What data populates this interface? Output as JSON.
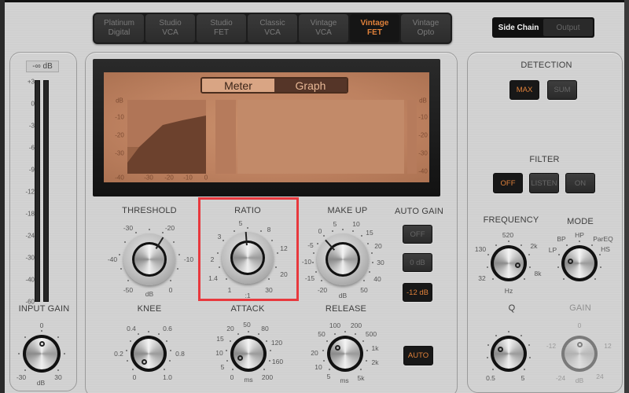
{
  "models": [
    {
      "label": "Platinum\nDigital",
      "line1": "Platinum",
      "line2": "Digital",
      "active": false
    },
    {
      "line1": "Studio",
      "line2": "VCA",
      "active": false
    },
    {
      "line1": "Studio",
      "line2": "FET",
      "active": false
    },
    {
      "line1": "Classic",
      "line2": "VCA",
      "active": false
    },
    {
      "line1": "Vintage",
      "line2": "VCA",
      "active": false
    },
    {
      "line1": "Vintage",
      "line2": "FET",
      "active": true
    },
    {
      "line1": "Vintage",
      "line2": "Opto",
      "active": false
    }
  ],
  "sidechain_toggle": {
    "side_chain": "Side Chain",
    "output": "Output",
    "selected": "Side Chain"
  },
  "input_meter": {
    "readout": "-∞ dB",
    "scale": [
      "+3",
      "0",
      "-3",
      "-6",
      "-9",
      "-12",
      "-18",
      "-24",
      "-30",
      "-40",
      "-60"
    ]
  },
  "input_gain": {
    "label": "INPUT GAIN",
    "top": "0",
    "min": "-30",
    "max": "30",
    "unit": "dB",
    "value_db": 0
  },
  "display": {
    "tabs": {
      "meter": "Meter",
      "graph": "Graph",
      "selected": "Graph"
    },
    "graph_y_labels": [
      "dB",
      "-10",
      "-20",
      "-30",
      "-40"
    ],
    "graph_x_labels": [
      "-30",
      "-20",
      "-10",
      "0"
    ],
    "right_labels": [
      "dB",
      "-10",
      "-20",
      "-30",
      "-40"
    ]
  },
  "threshold": {
    "label": "THRESHOLD",
    "scale": [
      "-30",
      "-20",
      "-40",
      "-10",
      "-50",
      "0"
    ],
    "unit": "dB",
    "value_db": -20
  },
  "ratio": {
    "label": "RATIO",
    "scale": [
      "5",
      "8",
      "3",
      "12",
      "2",
      "20",
      "1.4",
      "30",
      "1"
    ],
    "unit": ":1",
    "value": 5
  },
  "make_up": {
    "label": "MAKE UP",
    "scale": [
      "5",
      "10",
      "0",
      "15",
      "-5",
      "20",
      "-10",
      "30",
      "-15",
      "40",
      "-20",
      "50"
    ],
    "unit": "dB",
    "value_db": 0
  },
  "auto_gain": {
    "label": "AUTO GAIN",
    "options": [
      "OFF",
      "0 dB",
      "-12 dB"
    ],
    "selected": "-12 dB"
  },
  "knee": {
    "label": "KNEE",
    "scale": [
      "0.4",
      "0.6",
      "0.2",
      "0.8",
      "0",
      "1.0"
    ],
    "value": 0.1
  },
  "attack": {
    "label": "ATTACK",
    "scale": [
      "50",
      "20",
      "80",
      "15",
      "120",
      "10",
      "160",
      "5",
      "0",
      "200"
    ],
    "unit": "ms",
    "value_ms": 10
  },
  "release": {
    "label": "RELEASE",
    "scale": [
      "100",
      "200",
      "50",
      "500",
      "1k",
      "20",
      "2k",
      "10",
      "5",
      "5k"
    ],
    "unit": "ms",
    "value_ms": 20,
    "auto_label": "AUTO"
  },
  "detection": {
    "label": "DETECTION",
    "options": [
      "MAX",
      "SUM"
    ],
    "selected": "MAX"
  },
  "filter": {
    "label": "FILTER",
    "options": [
      "OFF",
      "LISTEN",
      "ON"
    ],
    "selected": "OFF"
  },
  "frequency": {
    "label": "FREQUENCY",
    "scale": [
      "520",
      "130",
      "2k",
      "32",
      "8k"
    ],
    "unit": "Hz"
  },
  "mode": {
    "label": "MODE",
    "scale": [
      "HP",
      "BP",
      "ParEQ",
      "LP",
      "HS"
    ],
    "value": "LP"
  },
  "q": {
    "label": "Q",
    "min": "0.5",
    "max": "5"
  },
  "gain": {
    "label": "GAIN",
    "top": "0",
    "left": "-12",
    "right": "12",
    "min": "-24",
    "max": "24",
    "unit": "dB",
    "enabled": false
  },
  "colors": {
    "accent": "#e0813a",
    "highlight": "#e8383d",
    "screen": "#c08563"
  }
}
